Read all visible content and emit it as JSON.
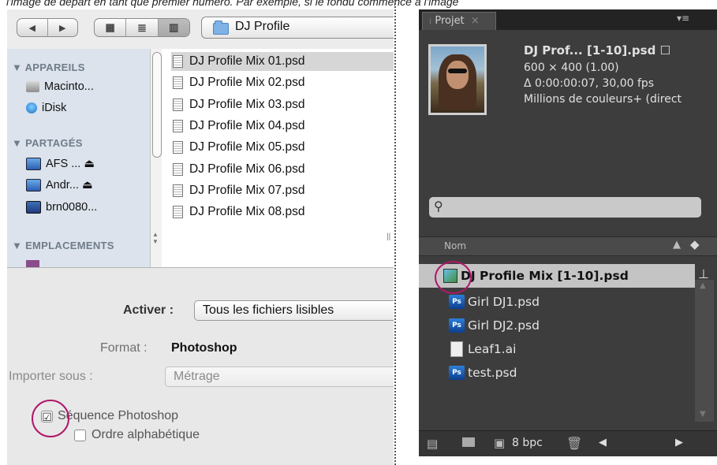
{
  "caption": "l'image de départ en tant que premier numéro. Par exemple, si le fondu commence à l'image",
  "mac": {
    "nav": {
      "back": "◀",
      "forward": "▶"
    },
    "location": "DJ Profile",
    "sidebar": {
      "sections": [
        {
          "title": "▼ APPAREILS",
          "items": [
            "Macinto...",
            "iDisk"
          ]
        },
        {
          "title": "▼ PARTAGÉS",
          "items": [
            "AFS ... ⏏",
            "Andr... ⏏",
            "brn0080..."
          ]
        },
        {
          "title": "▼ EMPLACEMENTS",
          "items": []
        }
      ]
    },
    "files": [
      "DJ Profile Mix 01.psd",
      "DJ Profile Mix 02.psd",
      "DJ Profile Mix 03.psd",
      "DJ Profile Mix 04.psd",
      "DJ Profile Mix 05.psd",
      "DJ Profile Mix 06.psd",
      "DJ Profile Mix 07.psd",
      "DJ Profile Mix 08.psd"
    ],
    "enable_label": "Activer :",
    "enable_value": "Tous les fichiers lisibles",
    "format_label": "Format :",
    "format_value": "Photoshop",
    "import_label": "Importer sous :",
    "import_value": "Métrage",
    "seq_label": "Séquence Photoshop",
    "seq_checked": "☑",
    "alpha_label": "Ordre alphabétique",
    "highlight_color": "#b0186a"
  },
  "ae": {
    "tab": "Projet",
    "tab_close": "×",
    "menu_icon": "▾≡",
    "info": {
      "name": "DJ Prof... [1-10].psd ☐",
      "size": "600 × 400 (1.00)",
      "duration": "Δ 0:00:00:07, 30,00 fps",
      "colors": "Millions de couleurs+ (direct"
    },
    "search_icon": "⚲",
    "column": "Nom",
    "rows": [
      {
        "name": "DJ Profile Mix [1-10].psd",
        "type": "sequence"
      },
      {
        "name": "Girl DJ1.psd",
        "type": "ps"
      },
      {
        "name": "Girl DJ2.psd",
        "type": "ps"
      },
      {
        "name": "Leaf1.ai",
        "type": "ai"
      },
      {
        "name": "test.psd",
        "type": "ps"
      }
    ],
    "ps_badge": "Ps",
    "bpc": "8 bpc"
  }
}
